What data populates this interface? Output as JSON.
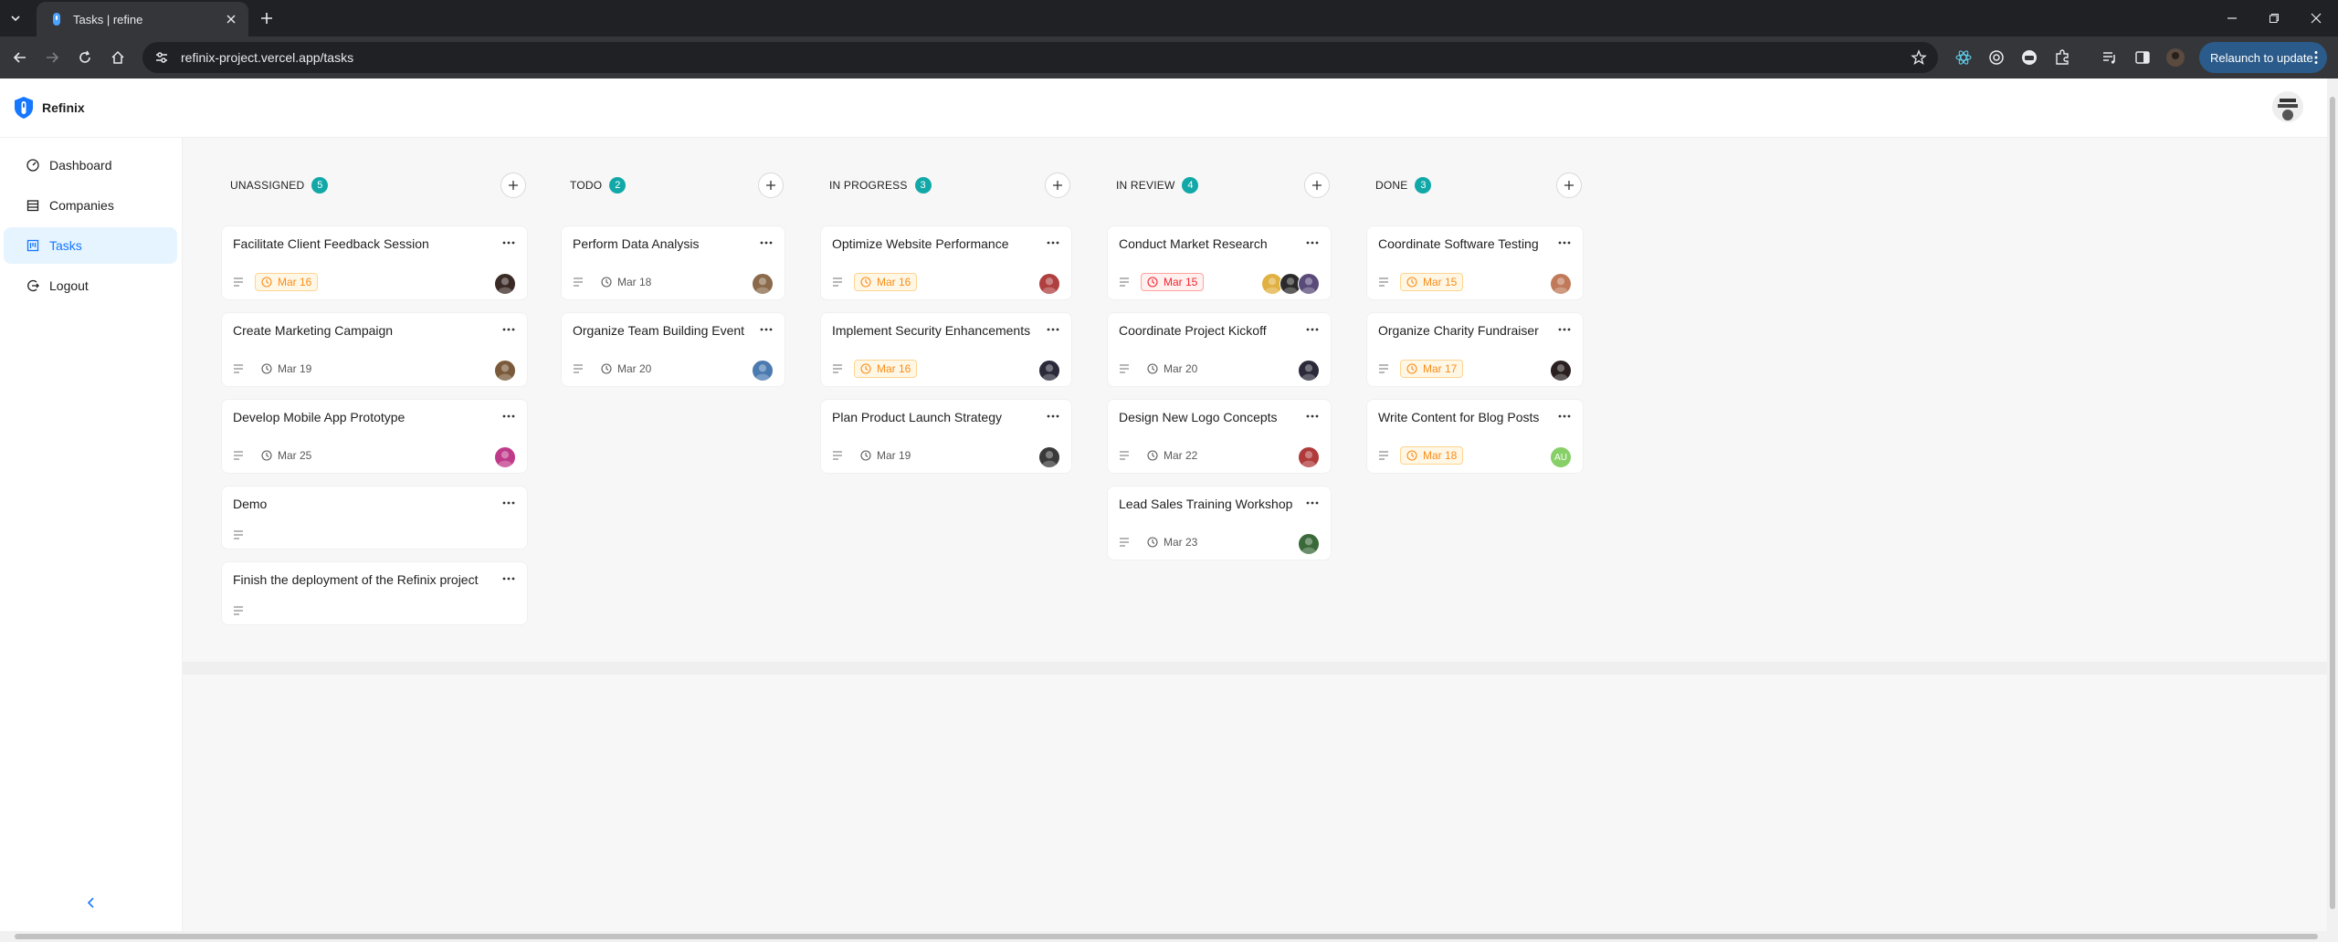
{
  "browser": {
    "tab_title": "Tasks | refine",
    "url": "refinix-project.vercel.app/tasks",
    "relaunch_label": "Relaunch to update"
  },
  "app": {
    "brand": "Refinix",
    "menu": [
      {
        "label": "Dashboard",
        "icon": "dashboard-icon",
        "active": false
      },
      {
        "label": "Companies",
        "icon": "shop-icon",
        "active": false
      },
      {
        "label": "Tasks",
        "icon": "project-icon",
        "active": true
      },
      {
        "label": "Logout",
        "icon": "logout-icon",
        "active": false
      }
    ]
  },
  "colors": {
    "accent": "#1677ff",
    "count_badge": "#13a8a8",
    "warning": "#fa8c16",
    "error": "#f5222d"
  },
  "columns": [
    {
      "title": "UNASSIGNED",
      "count": "5",
      "cards": [
        {
          "title": "Facilitate Client Feedback Session",
          "date": "Mar 16",
          "status": "warn",
          "avatars": [
            {
              "color": "#3a2a25"
            }
          ]
        },
        {
          "title": "Create Marketing Campaign",
          "date": "Mar 19",
          "status": "normal",
          "avatars": [
            {
              "color": "#7a5a3a"
            }
          ]
        },
        {
          "title": "Develop Mobile App Prototype",
          "date": "Mar 25",
          "status": "normal",
          "avatars": [
            {
              "color": "#c03a8a"
            }
          ]
        },
        {
          "title": "Demo",
          "date": "",
          "status": "none",
          "avatars": []
        },
        {
          "title": "Finish the deployment of the Refinix project",
          "date": "",
          "status": "none",
          "avatars": []
        }
      ]
    },
    {
      "title": "TODO",
      "count": "2",
      "cards": [
        {
          "title": "Perform Data Analysis",
          "date": "Mar 18",
          "status": "normal",
          "avatars": [
            {
              "color": "#8a6a4a"
            }
          ]
        },
        {
          "title": "Organize Team Building Event",
          "date": "Mar 20",
          "status": "normal",
          "avatars": [
            {
              "color": "#4a7ab0"
            }
          ]
        }
      ]
    },
    {
      "title": "IN PROGRESS",
      "count": "3",
      "cards": [
        {
          "title": "Optimize Website Performance",
          "date": "Mar 16",
          "status": "warn",
          "avatars": [
            {
              "color": "#b04040"
            }
          ]
        },
        {
          "title": "Implement Security Enhancements",
          "date": "Mar 16",
          "status": "warn",
          "avatars": [
            {
              "color": "#2a2a3a"
            }
          ]
        },
        {
          "title": "Plan Product Launch Strategy",
          "date": "Mar 19",
          "status": "normal",
          "avatars": [
            {
              "color": "#3a3a3a"
            }
          ]
        }
      ]
    },
    {
      "title": "IN REVIEW",
      "count": "4",
      "cards": [
        {
          "title": "Conduct Market Research",
          "date": "Mar 15",
          "status": "err",
          "avatars": [
            {
              "color": "#e0b040"
            },
            {
              "color": "#2a2a2a"
            },
            {
              "color": "#5a4a7a"
            }
          ]
        },
        {
          "title": "Coordinate Project Kickoff",
          "date": "Mar 20",
          "status": "normal",
          "avatars": [
            {
              "color": "#2a2a3a"
            }
          ]
        },
        {
          "title": "Design New Logo Concepts",
          "date": "Mar 22",
          "status": "normal",
          "avatars": [
            {
              "color": "#b03a3a"
            }
          ]
        },
        {
          "title": "Lead Sales Training Workshop",
          "date": "Mar 23",
          "status": "normal",
          "avatars": [
            {
              "color": "#3a6a3a"
            }
          ]
        }
      ]
    },
    {
      "title": "DONE",
      "count": "3",
      "cards": [
        {
          "title": "Coordinate Software Testing",
          "date": "Mar 15",
          "status": "warn",
          "avatars": [
            {
              "color": "#c07a5a"
            }
          ]
        },
        {
          "title": "Organize Charity Fundraiser",
          "date": "Mar 17",
          "status": "warn",
          "avatars": [
            {
              "color": "#2a2020"
            }
          ]
        },
        {
          "title": "Write Content for Blog Posts",
          "date": "Mar 18",
          "status": "warn",
          "avatars": [
            {
              "color": "#87d068",
              "initials": "AU"
            }
          ]
        }
      ]
    }
  ]
}
